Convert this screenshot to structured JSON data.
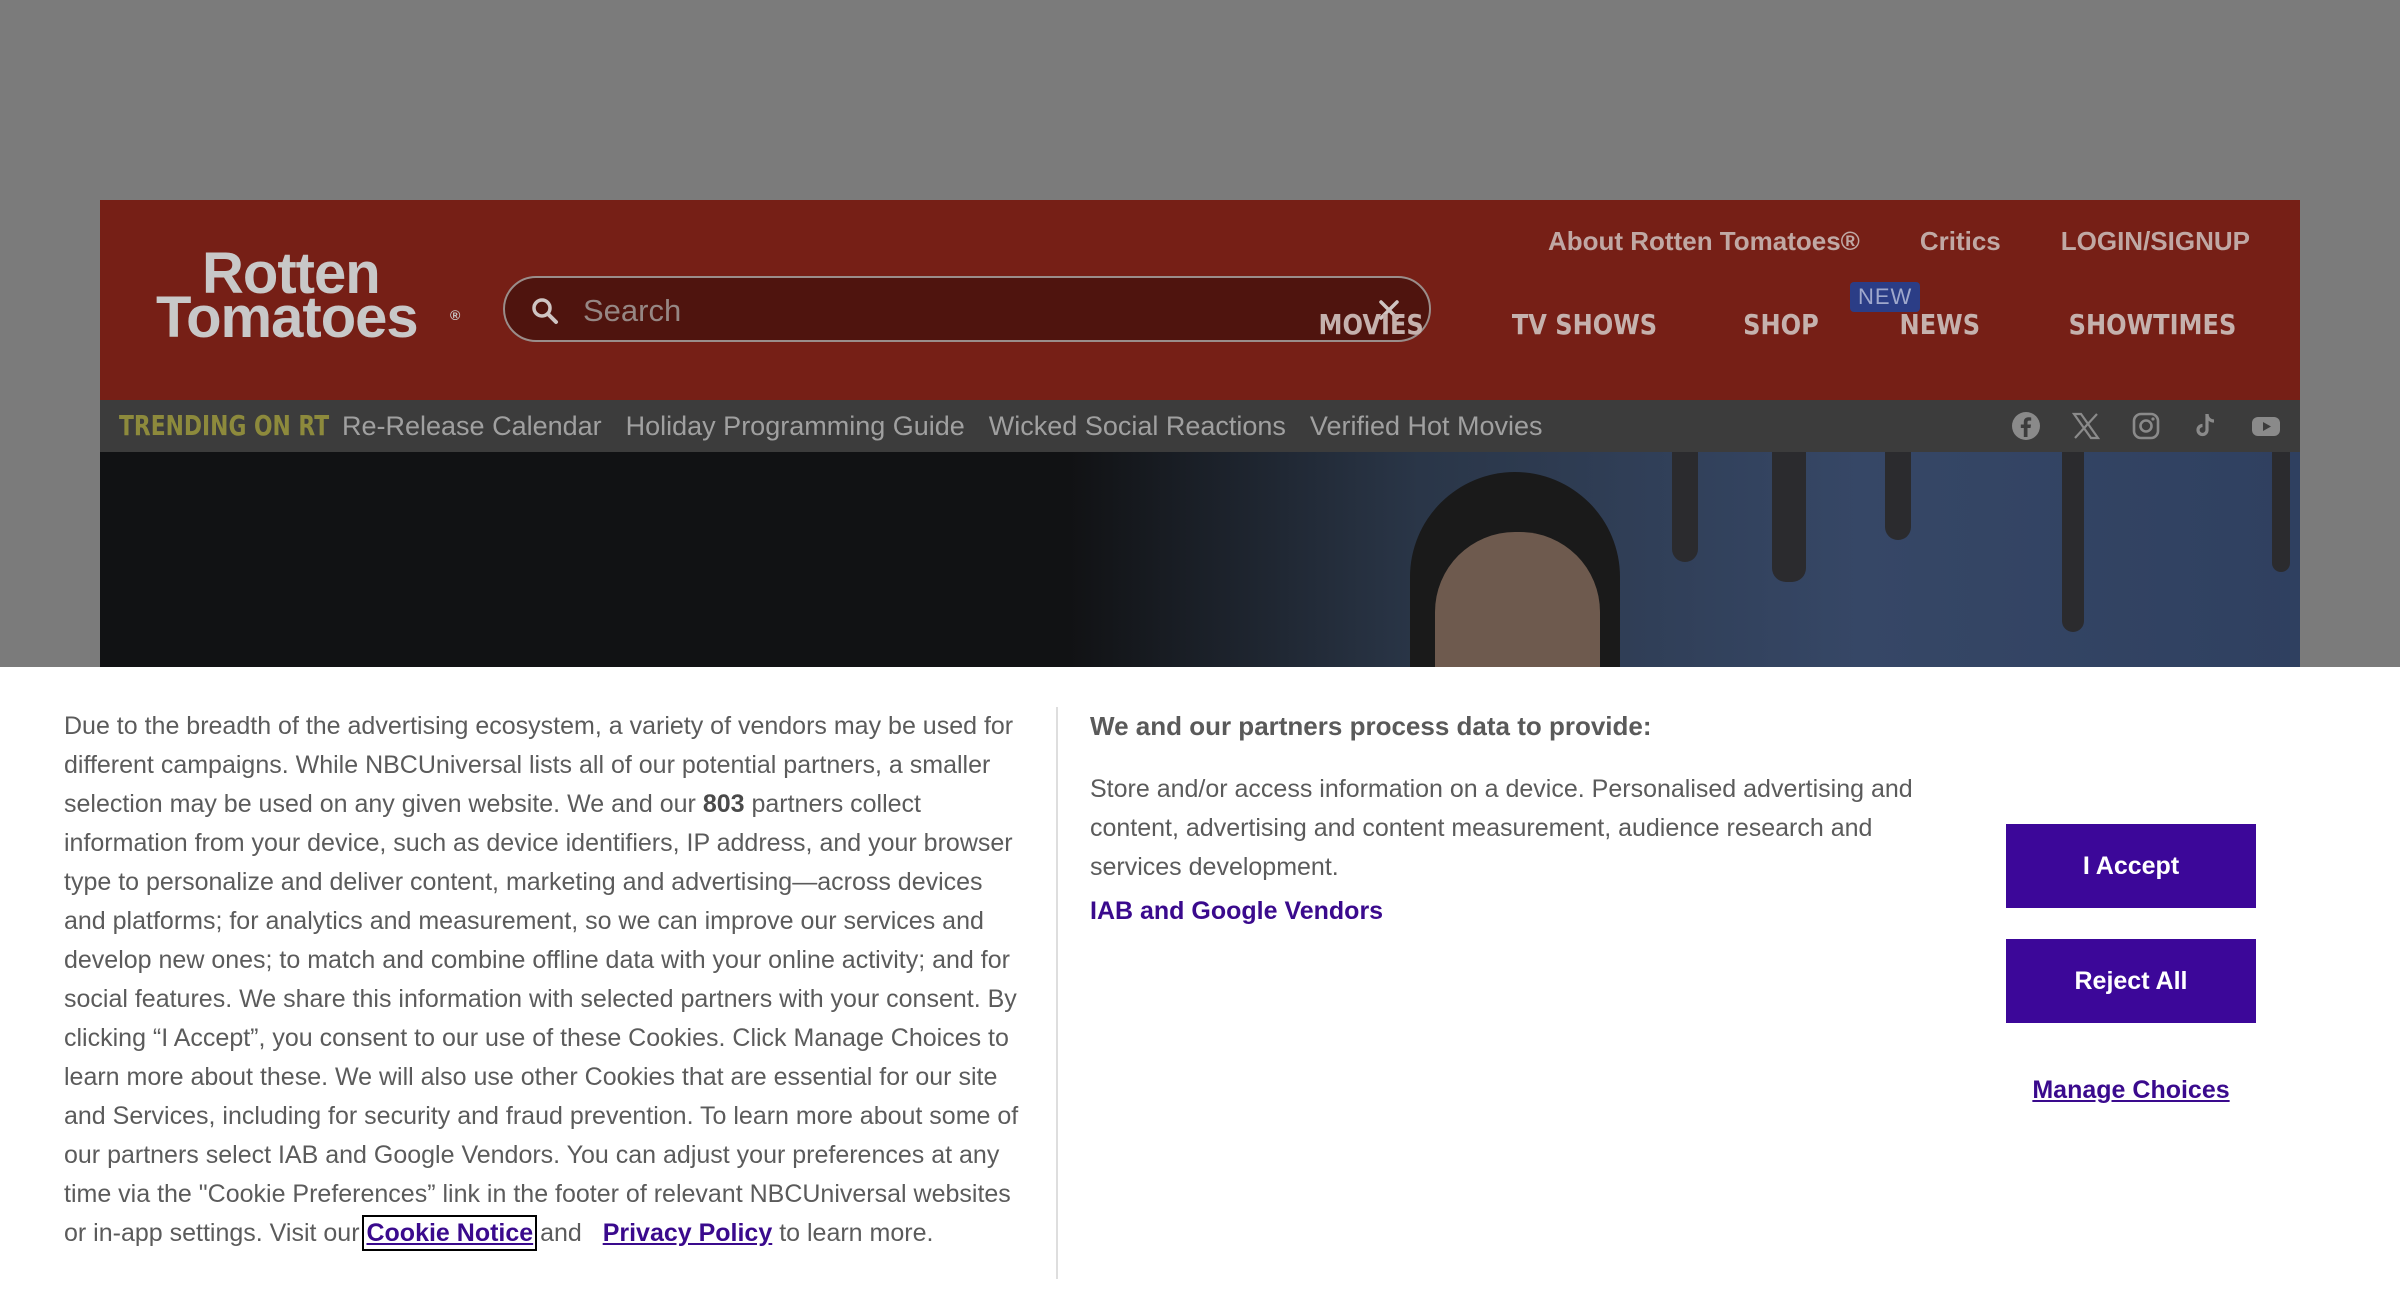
{
  "header": {
    "logo_line1": "Rotten",
    "logo_line2": "Tomatoes",
    "logo_reg": "®",
    "search_placeholder": "Search",
    "top_links": [
      "About Rotten Tomatoes®",
      "Critics",
      "LOGIN/SIGNUP"
    ],
    "main_nav": [
      "MOVIES",
      "TV SHOWS",
      "SHOP",
      "NEWS",
      "SHOWTIMES"
    ],
    "shop_badge": "NEW"
  },
  "trending": {
    "label": "TRENDING ON RT",
    "links": [
      "Re-Release Calendar",
      "Holiday Programming Guide",
      "Wicked Social Reactions",
      "Verified Hot Movies"
    ],
    "social_icons": [
      "facebook-icon",
      "x-icon",
      "instagram-icon",
      "tiktok-icon",
      "youtube-icon"
    ]
  },
  "consent": {
    "body_pre_count": "Due to the breadth of the advertising ecosystem, a variety of vendors may be used for different campaigns. While NBCUniversal lists all of our potential partners, a smaller selection may be used on any given website. We and our ",
    "partner_count": "803",
    "body_post_count": " partners collect information from your device, such as device identifiers, IP address, and your browser type to personalize and deliver content, marketing and advertising—across devices and platforms; for analytics and measurement, so we can improve our services and develop new ones; to match and combine offline data with your online activity; and for social features. We share this information with selected partners with your consent. By clicking “I Accept”, you consent to our use of these Cookies. Click Manage Choices to learn more about these. We will also use other Cookies that are essential for our site and Services, including for security and fraud prevention. To learn more about some of our partners select IAB and Google Vendors. You can adjust your preferences at any time via the \"Cookie Preferences” link in the footer of relevant NBCUniversal websites or in-app settings. Visit our ",
    "cookie_notice_link": "Cookie Notice",
    "and_text": "and",
    "privacy_policy_link": "Privacy Policy",
    "tail_text": " to learn more.",
    "purposes_heading": "We and our partners process data to provide:",
    "purposes_text": "Store and/or access information on a device. Personalised advertising and content, advertising and content measurement, audience research and services development.",
    "vendors_link": "IAB and Google Vendors",
    "accept_label": "I Accept",
    "reject_label": "Reject All",
    "manage_label": "Manage Choices"
  }
}
